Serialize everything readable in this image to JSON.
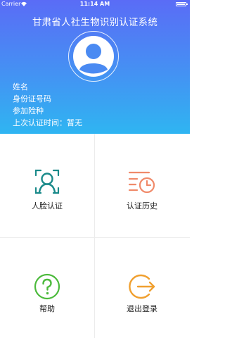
{
  "status_bar": {
    "carrier": "Carrier",
    "time": "11:14 AM"
  },
  "header": {
    "title": "甘肃省人社生物识别认证系统",
    "avatar_icon": "user-avatar-icon",
    "info": {
      "name_label": "姓名",
      "id_label": "身份证号码",
      "insurance_label": "参加险种",
      "last_auth_label": "上次认证时间：暂无"
    }
  },
  "menu": {
    "face_auth": {
      "label": "人脸认证",
      "icon": "face-scan-icon",
      "color": "#1a8a8a"
    },
    "history": {
      "label": "认证历史",
      "icon": "history-clock-icon",
      "color": "#f08a6a"
    },
    "help": {
      "label": "帮助",
      "icon": "question-icon",
      "color": "#4cba3c"
    },
    "logout": {
      "label": "退出登录",
      "icon": "logout-icon",
      "color": "#f0a030"
    }
  },
  "colors": {
    "header_top": "#5a6cf6",
    "header_bottom": "#2fb5f2",
    "divider": "#ececec"
  }
}
